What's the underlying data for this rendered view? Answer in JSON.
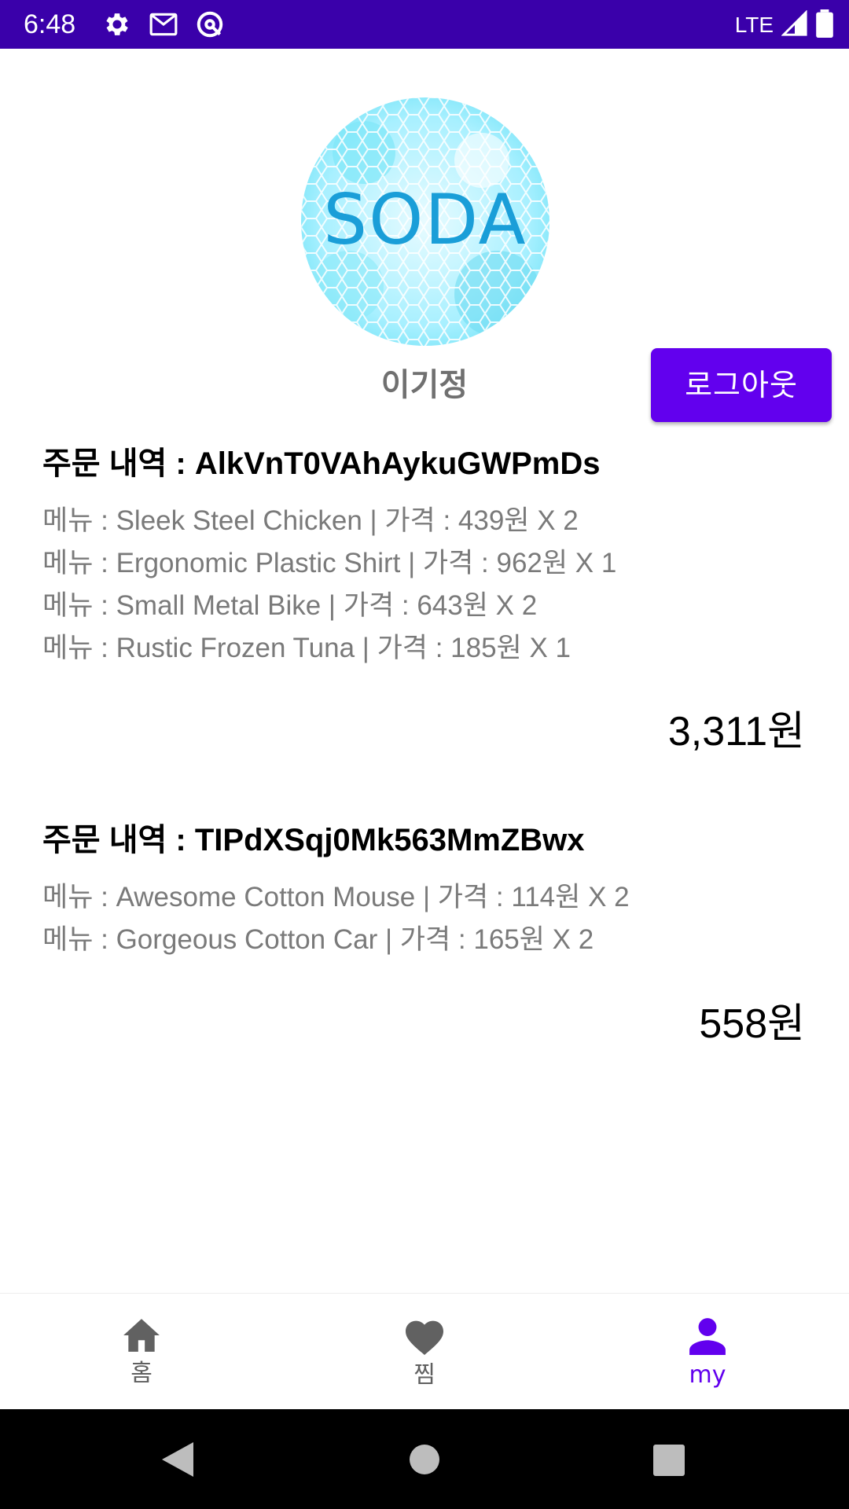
{
  "status_bar": {
    "time": "6:48",
    "network": "LTE",
    "icons": [
      "settings-icon",
      "gmail-icon",
      "sync-icon",
      "signal-icon",
      "battery-icon"
    ]
  },
  "profile": {
    "avatar_text": "SODA",
    "username": "이기정",
    "logout_label": "로그아웃"
  },
  "orders": [
    {
      "title": "주문 내역 : AlkVnT0VAhAykuGWPmDs",
      "items": [
        "메뉴 : Sleek Steel Chicken | 가격 : 439원 X 2",
        "메뉴 : Ergonomic Plastic Shirt | 가격 : 962원 X 1",
        "메뉴 : Small Metal Bike | 가격 : 643원 X 2",
        "메뉴 : Rustic Frozen Tuna | 가격 : 185원 X 1"
      ],
      "total": "3,311원"
    },
    {
      "title": "주문 내역 : TIPdXSqj0Mk563MmZBwx",
      "items": [
        "메뉴 : Awesome Cotton Mouse | 가격 : 114원 X 2",
        "메뉴 : Gorgeous Cotton Car | 가격 : 165원 X 2"
      ],
      "total": "558원"
    }
  ],
  "bottom_nav": {
    "items": [
      {
        "label": "홈",
        "icon": "home-icon",
        "active": false
      },
      {
        "label": "찜",
        "icon": "heart-icon",
        "active": false
      },
      {
        "label": "my",
        "icon": "person-icon",
        "active": true
      }
    ]
  },
  "colors": {
    "status_bar": "#3a00aa",
    "accent": "#6200ee",
    "secondary_text": "#7a7a7a"
  }
}
